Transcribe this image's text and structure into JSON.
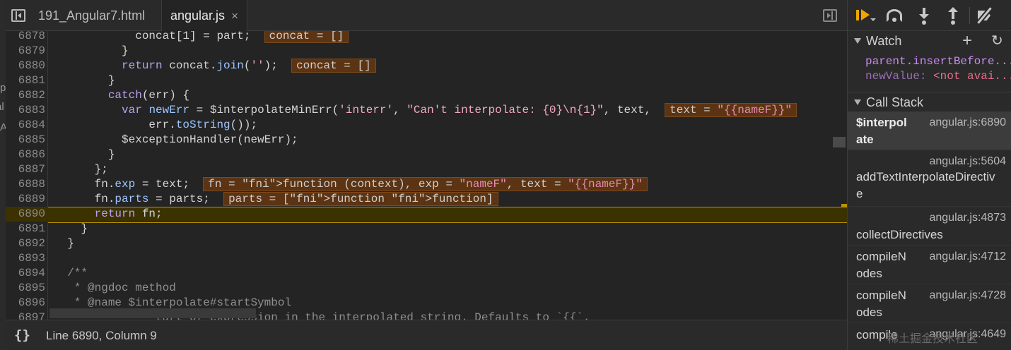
{
  "tabs": [
    {
      "label": "191_Angular7.html"
    },
    {
      "label": "angular.js",
      "close": "×"
    }
  ],
  "editor": {
    "lines": [
      {
        "num": "6878",
        "segs": [
          {
            "t": "            concat[1] = part;  "
          },
          {
            "t": "concat = []",
            "c": "inl"
          }
        ]
      },
      {
        "num": "6879",
        "segs": [
          {
            "t": "          }"
          }
        ]
      },
      {
        "num": "6880",
        "segs": [
          {
            "t": "          "
          },
          {
            "t": "return",
            "c": "kw"
          },
          {
            "t": " concat."
          },
          {
            "t": "join",
            "c": "fn"
          },
          {
            "t": "("
          },
          {
            "t": "''",
            "c": "str"
          },
          {
            "t": ");  "
          },
          {
            "t": "concat = []",
            "c": "inl"
          }
        ]
      },
      {
        "num": "6881",
        "segs": [
          {
            "t": "        }"
          }
        ]
      },
      {
        "num": "6882",
        "segs": [
          {
            "t": "        "
          },
          {
            "t": "catch",
            "c": "kw"
          },
          {
            "t": "(err) {"
          }
        ]
      },
      {
        "num": "6883",
        "segs": [
          {
            "t": "          "
          },
          {
            "t": "var",
            "c": "kw"
          },
          {
            "t": " "
          },
          {
            "t": "newErr",
            "c": "fn"
          },
          {
            "t": " = $interpolateMinErr("
          },
          {
            "t": "'interr'",
            "c": "str"
          },
          {
            "t": ", "
          },
          {
            "t": "\"Can't interpolate: {0}\\n{1}\"",
            "c": "str"
          },
          {
            "t": ", text,  "
          },
          {
            "t": "text = \"{{nameF}}\"",
            "c": "inl"
          }
        ]
      },
      {
        "num": "6884",
        "segs": [
          {
            "t": "              err."
          },
          {
            "t": "toString",
            "c": "fn"
          },
          {
            "t": "());"
          }
        ]
      },
      {
        "num": "6885",
        "segs": [
          {
            "t": "          $exceptionHandler(newErr);"
          }
        ]
      },
      {
        "num": "6886",
        "segs": [
          {
            "t": "        }"
          }
        ]
      },
      {
        "num": "6887",
        "segs": [
          {
            "t": "      };"
          }
        ]
      },
      {
        "num": "6888",
        "segs": [
          {
            "t": "      fn."
          },
          {
            "t": "exp",
            "c": "fn"
          },
          {
            "t": " = text;  "
          },
          {
            "t": "fn = function (context), exp = \"nameF\", text = \"{{nameF}}\"",
            "c": "inl"
          }
        ]
      },
      {
        "num": "6889",
        "segs": [
          {
            "t": "      fn."
          },
          {
            "t": "parts",
            "c": "fn"
          },
          {
            "t": " = parts;  "
          },
          {
            "t": "parts = [function function]",
            "c": "inl"
          }
        ]
      },
      {
        "num": "6890",
        "current": true,
        "segs": [
          {
            "t": "      "
          },
          {
            "t": "return",
            "c": "kw"
          },
          {
            "t": " fn;"
          }
        ]
      },
      {
        "num": "6891",
        "segs": [
          {
            "t": "    }"
          }
        ]
      },
      {
        "num": "6892",
        "segs": [
          {
            "t": "  }"
          }
        ]
      },
      {
        "num": "6893",
        "segs": [
          {
            "t": ""
          }
        ]
      },
      {
        "num": "6894",
        "segs": [
          {
            "t": "  /**",
            "c": "cm"
          }
        ]
      },
      {
        "num": "6895",
        "segs": [
          {
            "t": "   * @ngdoc method",
            "c": "cm"
          }
        ]
      },
      {
        "num": "6896",
        "segs": [
          {
            "t": "   * @name $interpolate#startSymbol",
            "c": "cm"
          }
        ]
      },
      {
        "num": "6897",
        "segs": [
          {
            "t": "               ",
            "c": "cm"
          },
          {
            "t": "tart of expression in the interpolated string. Defaults to `{{`.",
            "c": "cm"
          }
        ]
      }
    ]
  },
  "status": {
    "braces": "{}",
    "position": "Line 6890, Column 9"
  },
  "sliver": {
    "chars": [
      "p",
      "al",
      "A"
    ]
  },
  "debugger": {
    "watch": {
      "title": "Watch",
      "add": "+",
      "refresh": "↻",
      "items": [
        {
          "expr": "parent.insertBefore..."
        },
        {
          "label": "newValue: ",
          "value": "<not avai..."
        }
      ]
    },
    "callstack": {
      "title": "Call Stack",
      "frames": [
        {
          "name": "$interpol\nate",
          "loc": "angular.js:6890",
          "selected": true
        },
        {
          "name": "addTextInterpolateDirectiv\ne",
          "loc": "angular.js:5604"
        },
        {
          "name": "collectDirectives",
          "loc": "angular.js:4873"
        },
        {
          "name": "compileN\nodes",
          "loc": "angular.js:4712"
        },
        {
          "name": "compileN\nodes",
          "loc": "angular.js:4728"
        },
        {
          "name": "compile",
          "loc": "angular.js:4649"
        }
      ]
    }
  },
  "watermark": "稀土掘金技术社区"
}
